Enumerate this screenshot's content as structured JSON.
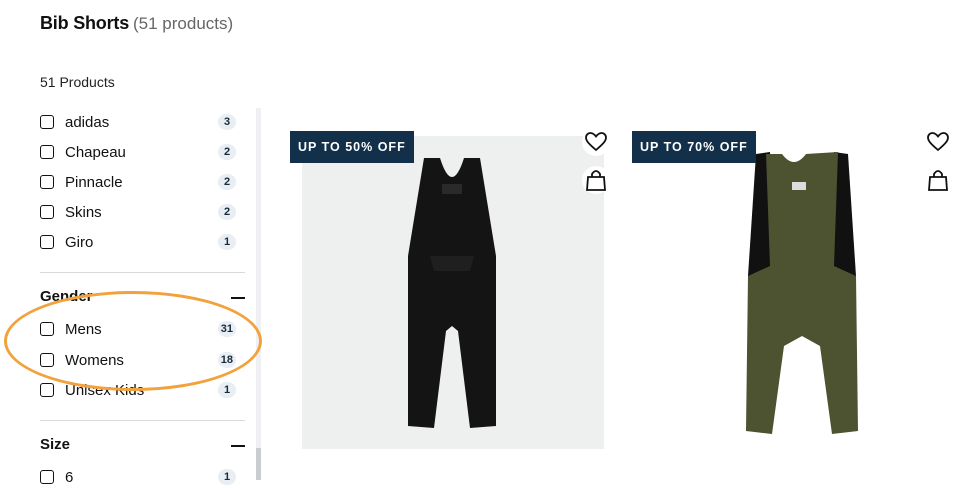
{
  "header": {
    "title": "Bib Shorts",
    "title_count": "(51 products)",
    "products_count": "51 Products"
  },
  "filters": {
    "brand_items": [
      {
        "label": "adidas",
        "count": "3"
      },
      {
        "label": "Chapeau",
        "count": "2"
      },
      {
        "label": "Pinnacle",
        "count": "2"
      },
      {
        "label": "Skins",
        "count": "2"
      },
      {
        "label": "Giro",
        "count": "1"
      }
    ],
    "gender": {
      "title": "Gender",
      "items": [
        {
          "label": "Mens",
          "count": "31"
        },
        {
          "label": "Womens",
          "count": "18"
        },
        {
          "label": "Unisex Kids",
          "count": "1"
        }
      ]
    },
    "size": {
      "title": "Size",
      "items": [
        {
          "label": "6",
          "count": "1"
        }
      ]
    }
  },
  "products": [
    {
      "promo": "UP TO 50% OFF",
      "image_bg": "#eef0ef",
      "garment_color": "#141414",
      "strap_color": "#141414"
    },
    {
      "promo": "UP TO 70% OFF",
      "image_bg": "#ffffff",
      "garment_color": "#4d5230",
      "strap_color": "#111111"
    }
  ],
  "colors": {
    "badge_bg": "#e8eef4",
    "promo_bg": "#12304a",
    "highlight": "#f2a23c"
  }
}
